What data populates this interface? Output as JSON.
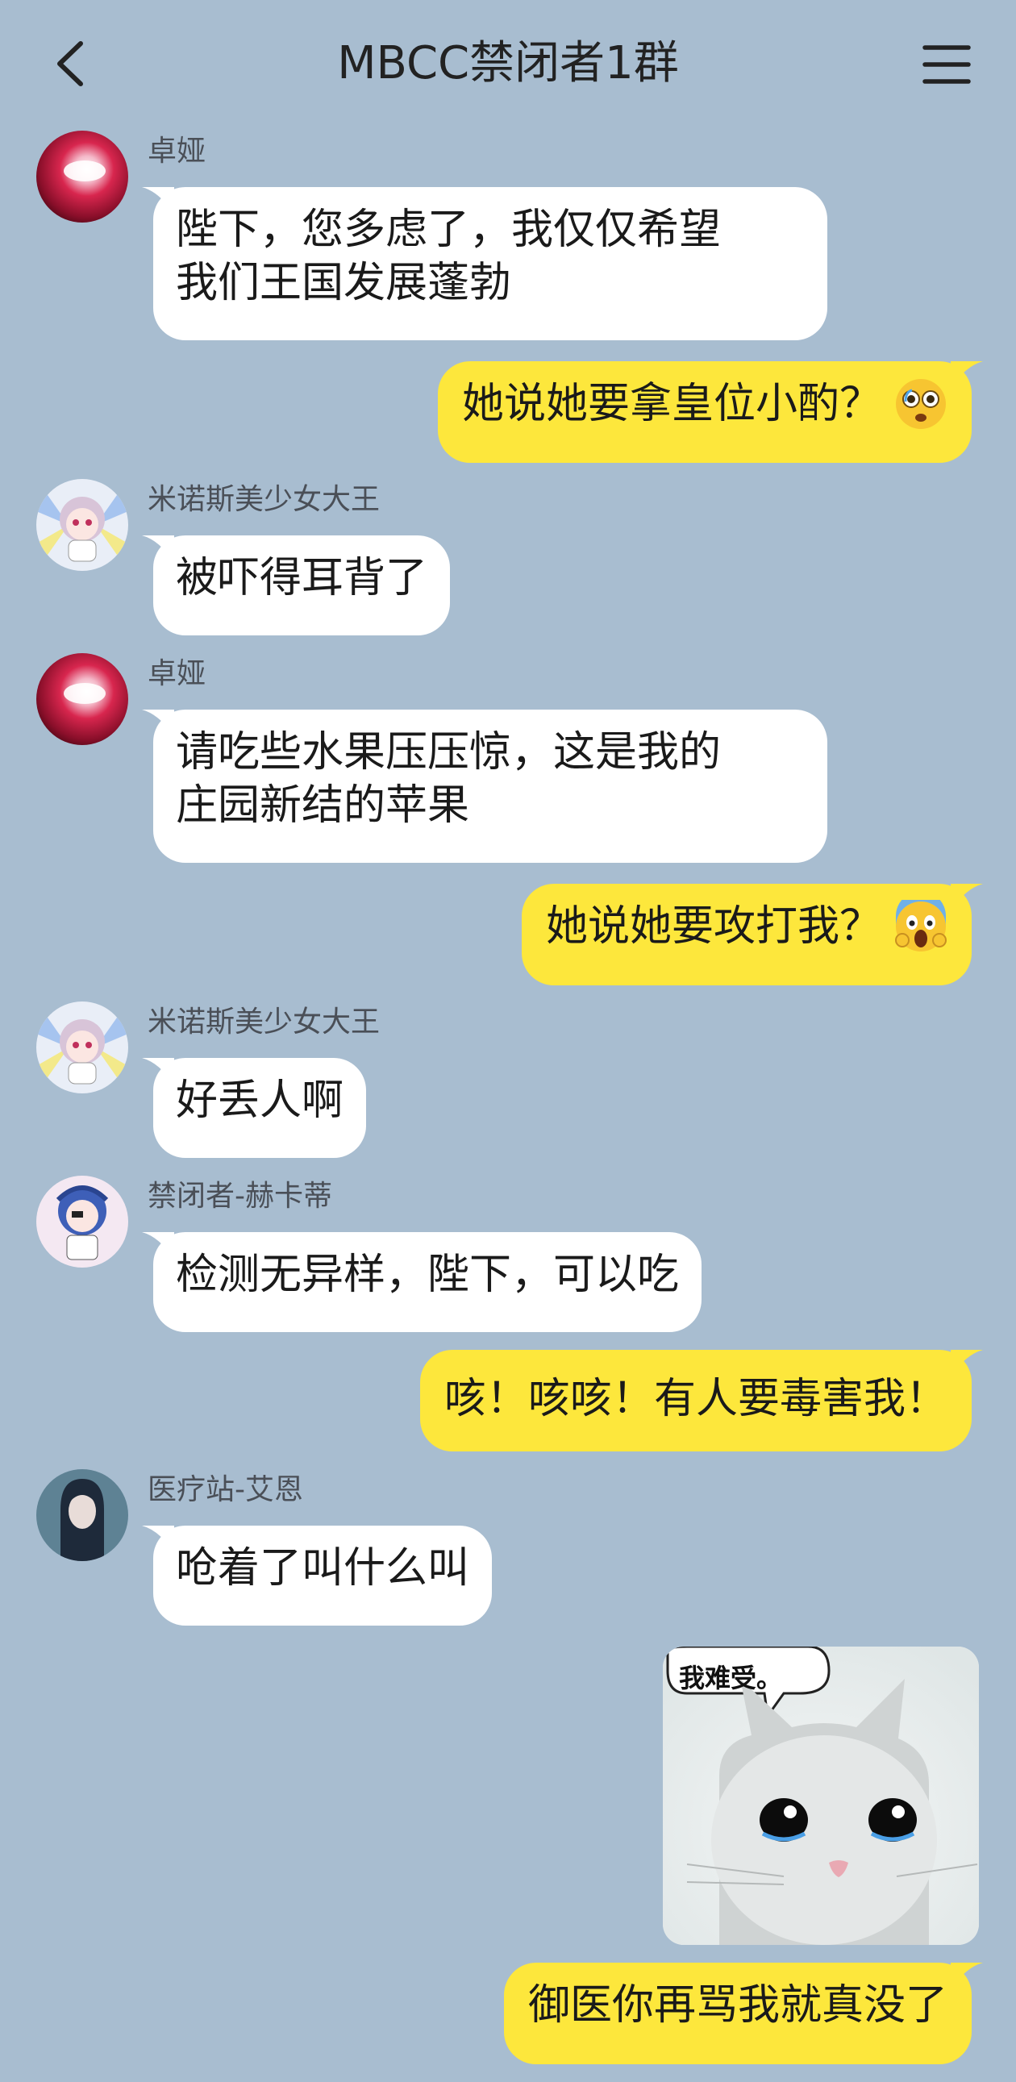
{
  "header": {
    "title": "MBCC禁闭者1群",
    "back_icon": "chevron-left-icon",
    "menu_icon": "hamburger-menu-icon"
  },
  "colors": {
    "background": "#a8bdd0",
    "incoming_bubble": "#ffffff",
    "outgoing_bubble": "#fde73c"
  },
  "messages": [
    {
      "side": "left",
      "sender": "卓娅",
      "lines": [
        "陛下，您多虑了，我仅仅希望",
        "我们王国发展蓬勃"
      ]
    },
    {
      "side": "right",
      "text": "她说她要拿皇位小酌？",
      "emoji": "flushed-face-icon"
    },
    {
      "side": "left",
      "sender": "米诺斯美少女大王",
      "text": "被吓得耳背了"
    },
    {
      "side": "left",
      "sender": "卓娅",
      "lines": [
        "请吃些水果压压惊，这是我的",
        "庄园新结的苹果"
      ]
    },
    {
      "side": "right",
      "text": "她说她要攻打我？",
      "emoji": "screaming-face-icon"
    },
    {
      "side": "left",
      "sender": "米诺斯美少女大王",
      "text": "好丢人啊"
    },
    {
      "side": "left",
      "sender": "禁闭者-赫卡蒂",
      "text": "检测无异样，陛下，可以吃"
    },
    {
      "side": "right",
      "text": "咳！咳咳！有人要毒害我！"
    },
    {
      "side": "left",
      "sender": "医疗站-艾恩",
      "text": "呛着了叫什么叫"
    },
    {
      "side": "right",
      "sticker_caption": "我难受。",
      "sticker": "crying-cat-sticker"
    },
    {
      "side": "right",
      "text": "御医你再骂我就真没了"
    }
  ]
}
